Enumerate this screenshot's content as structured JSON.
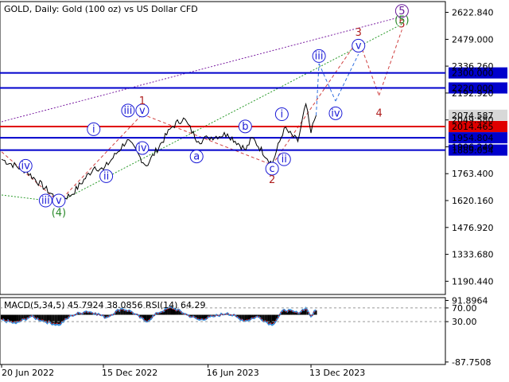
{
  "title": "GOLD, Daily:  Gold (100 oz) vs US Dollar CFD",
  "indicator_label": "MACD(5,34,5) 45.7924 38.0856 RSI(14) 64.29",
  "colors": {
    "price_line": "#000000",
    "blue_level": "#0000cc",
    "red_level": "#e00000",
    "wave_label": "#1a1ad6",
    "red_wave_label": "#b02020",
    "green_wave_label": "#2a8a2a",
    "purple_wave_label": "#6a1b9a",
    "green_dotted": "#2a9a2a",
    "purple_dotted": "#7b1fa2",
    "red_dashed": "#d04040",
    "blue_dashed": "#3070e0",
    "macd_hist": "#000000",
    "rsi_line": "#2f8fe0",
    "macd_signal": "#e00000"
  },
  "chart_data": [
    {
      "type": "line",
      "series": [
        {
          "values_x": [
            "2022-06-20",
            "2022-08-01",
            "2022-09-26",
            "2022-10-20",
            "2022-11-30",
            "2022-12-15",
            "2023-01-26",
            "2023-02-28",
            "2023-04-13",
            "2023-05-04",
            "2023-05-30",
            "2023-06-16",
            "2023-07-20",
            "2023-08-21",
            "2023-09-01",
            "2023-10-06",
            "2023-10-27",
            "2023-11-20",
            "2023-12-04",
            "2023-12-13",
            "2023-12-22"
          ],
          "values_y": [
            1840,
            1780,
            1625,
            1650,
            1800,
            1785,
            1945,
            1805,
            2010,
            2060,
            1935,
            1955,
            1975,
            1890,
            1955,
            1815,
            2005,
            1935,
            2135,
            1980,
            2074
          ]
        }
      ],
      "y_ticks": [
        "2622.840",
        "2479.000",
        "2336.260",
        "2192.920",
        "2049.580",
        "1906.240",
        "1763.400",
        "1620.160",
        "1476.920",
        "1333.680",
        "1190.440"
      ],
      "ylim": [
        1120,
        2680
      ],
      "x_tick_labels": [
        "20 Jun 2022",
        "15 Dec 2022",
        "16 Jun 2023",
        "13 Dec 2023"
      ],
      "levels": [
        {
          "value": "2300.000",
          "kind": "blue"
        },
        {
          "value": "2220.000",
          "kind": "blue"
        },
        {
          "value": "2074.587",
          "kind": "price"
        },
        {
          "value": "2014.465",
          "kind": "red"
        },
        {
          "value": "1954.804",
          "kind": "blue"
        },
        {
          "value": "1889.054",
          "kind": "blue"
        }
      ],
      "wave_labels": [
        {
          "text": "iv",
          "kind": "circle",
          "date": "2022-08-01",
          "value": 1805
        },
        {
          "text": "iii",
          "kind": "circle",
          "date": "2022-09-05",
          "value": 1620
        },
        {
          "text": "v",
          "kind": "circle",
          "date": "2022-09-28",
          "value": 1620
        },
        {
          "text": "(4)",
          "kind": "green",
          "date": "2022-09-28",
          "value": 1555
        },
        {
          "text": "i",
          "kind": "circle",
          "date": "2022-11-28",
          "value": 2000
        },
        {
          "text": "ii",
          "kind": "circle",
          "date": "2022-12-20",
          "value": 1750
        },
        {
          "text": "iii",
          "kind": "circle",
          "date": "2023-01-27",
          "value": 2100
        },
        {
          "text": "v",
          "kind": "circle",
          "date": "2023-02-21",
          "value": 2100
        },
        {
          "text": "1",
          "kind": "red",
          "date": "2023-02-21",
          "value": 2150
        },
        {
          "text": "iv",
          "kind": "circle",
          "date": "2023-02-21",
          "value": 1900
        },
        {
          "text": "a",
          "kind": "circle",
          "date": "2023-05-27",
          "value": 1855
        },
        {
          "text": "b",
          "kind": "circle",
          "date": "2023-08-20",
          "value": 2015
        },
        {
          "text": "c",
          "kind": "circle",
          "date": "2023-10-06",
          "value": 1790
        },
        {
          "text": "2",
          "kind": "red",
          "date": "2023-10-06",
          "value": 1730
        },
        {
          "text": "i",
          "kind": "circle",
          "date": "2023-10-23",
          "value": 2080
        },
        {
          "text": "ii",
          "kind": "circle",
          "date": "2023-10-27",
          "value": 1840
        },
        {
          "text": "iii",
          "kind": "circle",
          "date": "2023-12-27",
          "value": 2390
        },
        {
          "text": "iv",
          "kind": "circle",
          "date": "2024-01-25",
          "value": 2085
        },
        {
          "text": "v",
          "kind": "circle",
          "date": "2024-03-05",
          "value": 2445
        },
        {
          "text": "3",
          "kind": "red",
          "date": "2024-03-05",
          "value": 2515
        },
        {
          "text": "4",
          "kind": "red",
          "date": "2024-04-10",
          "value": 2085
        },
        {
          "text": "5",
          "kind": "circle-purple",
          "date": "2024-05-20",
          "value": 2630
        },
        {
          "text": "5",
          "kind": "red",
          "date": "2024-05-20",
          "value": 2560
        },
        {
          "text": "(5)",
          "kind": "green",
          "date": "2024-05-20",
          "value": 2580
        }
      ],
      "lines": [
        {
          "kind": "green_dotted",
          "from": {
            "date": "2022-06-20",
            "value": 1650
          },
          "to": {
            "date": "2022-09-28",
            "value": 1612
          }
        },
        {
          "kind": "green_dotted",
          "from": {
            "date": "2022-09-28",
            "value": 1612
          },
          "to": {
            "date": "2024-05-20",
            "value": 2560
          }
        },
        {
          "kind": "purple_dotted",
          "from": {
            "date": "2022-06-20",
            "value": 2040
          },
          "to": {
            "date": "2024-05-20",
            "value": 2600
          }
        },
        {
          "kind": "red_dashed",
          "from": {
            "date": "2022-06-20",
            "value": 1880
          },
          "to": {
            "date": "2022-09-28",
            "value": 1612
          }
        },
        {
          "kind": "red_dashed",
          "from": {
            "date": "2022-09-28",
            "value": 1612
          },
          "to": {
            "date": "2023-02-21",
            "value": 2080
          }
        },
        {
          "kind": "red_dashed",
          "from": {
            "date": "2023-02-21",
            "value": 2080
          },
          "to": {
            "date": "2023-10-06",
            "value": 1810
          }
        },
        {
          "kind": "red_dashed",
          "from": {
            "date": "2023-10-06",
            "value": 1810
          },
          "to": {
            "date": "2024-03-05",
            "value": 2480
          }
        },
        {
          "kind": "red_dashed",
          "from": {
            "date": "2024-03-05",
            "value": 2480
          },
          "to": {
            "date": "2024-04-10",
            "value": 2180
          }
        },
        {
          "kind": "red_dashed",
          "from": {
            "date": "2024-04-10",
            "value": 2180
          },
          "to": {
            "date": "2024-05-20",
            "value": 2530
          }
        },
        {
          "kind": "blue_dashed",
          "from": {
            "date": "2023-12-22",
            "value": 2074
          },
          "to": {
            "date": "2023-12-27",
            "value": 2350
          }
        },
        {
          "kind": "blue_dashed",
          "from": {
            "date": "2023-12-27",
            "value": 2350
          },
          "to": {
            "date": "2024-01-25",
            "value": 2150
          }
        },
        {
          "kind": "blue_dashed",
          "from": {
            "date": "2024-01-25",
            "value": 2150
          },
          "to": {
            "date": "2024-03-05",
            "value": 2400
          }
        }
      ]
    },
    {
      "type": "area",
      "name": "MACD(5,34,5)",
      "y_ticks": [
        "91.8964",
        "70.00",
        "30.00",
        "-87.7508"
      ],
      "ylim": [
        -95,
        100
      ],
      "rsi": {
        "values_x": [
          "2022-06-20",
          "2022-07-15",
          "2022-08-10",
          "2022-09-05",
          "2022-09-28",
          "2022-10-20",
          "2022-11-15",
          "2022-12-01",
          "2022-12-20",
          "2023-01-15",
          "2023-02-01",
          "2023-02-28",
          "2023-03-20",
          "2023-04-13",
          "2023-05-10",
          "2023-06-01",
          "2023-06-25",
          "2023-07-20",
          "2023-08-20",
          "2023-09-10",
          "2023-10-06",
          "2023-10-27",
          "2023-11-20",
          "2023-12-04",
          "2023-12-13",
          "2023-12-22"
        ],
        "values_y": [
          35,
          25,
          45,
          30,
          20,
          48,
          60,
          55,
          42,
          68,
          60,
          30,
          55,
          72,
          50,
          35,
          45,
          55,
          32,
          45,
          20,
          65,
          55,
          70,
          45,
          64
        ]
      }
    }
  ]
}
